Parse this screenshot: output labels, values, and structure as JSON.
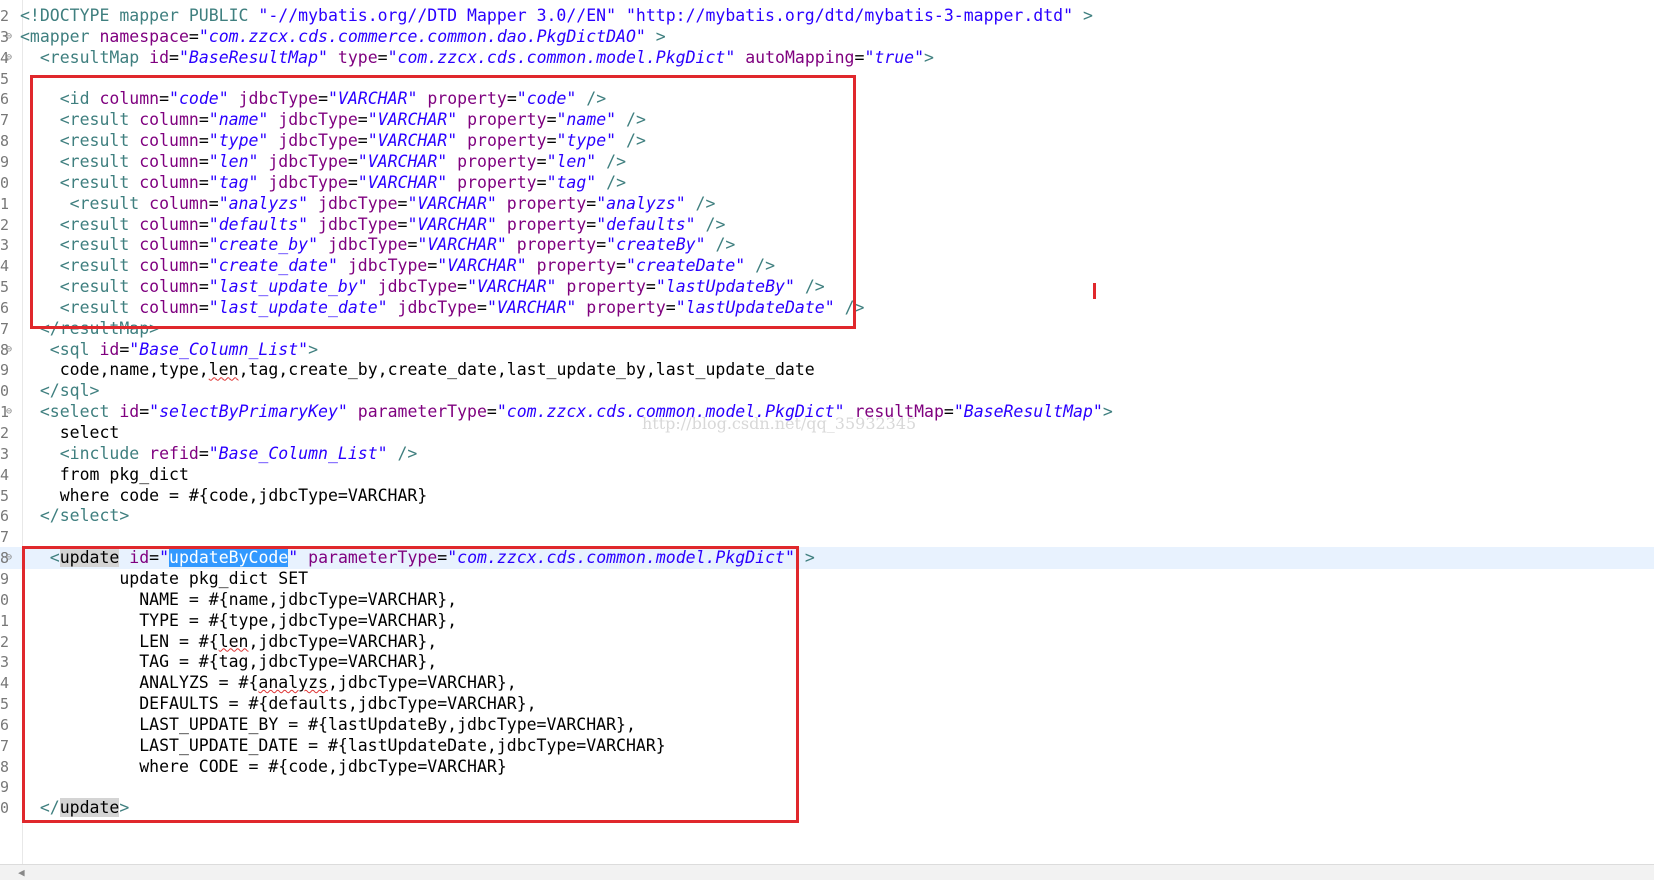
{
  "editor": {
    "lines": [
      {
        "no": "2",
        "fold": "",
        "segs": [
          [
            "tag",
            "<!DOCTYPE mapper PUBLIC "
          ],
          [
            "dval",
            "\"-//mybatis.org//DTD Mapper 3.0//EN\""
          ],
          [
            "tag",
            " "
          ],
          [
            "dval",
            "\"http://mybatis.org/dtd/mybatis-3-mapper.dtd\""
          ],
          [
            "tag",
            " >"
          ]
        ]
      },
      {
        "no": "3",
        "fold": "⊖",
        "segs": [
          [
            "tag",
            "<mapper "
          ],
          [
            "attr",
            "namespace"
          ],
          [
            "txt",
            "="
          ],
          [
            "val",
            "\"com.zzcx.cds.commerce.common.dao.PkgDictDAO\""
          ],
          [
            "tag",
            " >"
          ]
        ]
      },
      {
        "no": "4",
        "fold": "⊖",
        "segs": [
          [
            "tag",
            "  <resultMap "
          ],
          [
            "attr",
            "id"
          ],
          [
            "txt",
            "="
          ],
          [
            "val",
            "\"BaseResultMap\""
          ],
          [
            "tag",
            " "
          ],
          [
            "attr",
            "type"
          ],
          [
            "txt",
            "="
          ],
          [
            "val",
            "\"com.zzcx.cds.common.model.PkgDict\""
          ],
          [
            "tag",
            " "
          ],
          [
            "attr",
            "autoMapping"
          ],
          [
            "txt",
            "="
          ],
          [
            "val",
            "\"true\""
          ],
          [
            "tag",
            ">"
          ]
        ]
      },
      {
        "no": "5",
        "fold": "",
        "segs": []
      },
      {
        "no": "6",
        "fold": "",
        "segs": [
          [
            "tag",
            "    <id "
          ],
          [
            "attr",
            "column"
          ],
          [
            "txt",
            "="
          ],
          [
            "val",
            "\"code\""
          ],
          [
            "tag",
            " "
          ],
          [
            "attr",
            "jdbcType"
          ],
          [
            "txt",
            "="
          ],
          [
            "val",
            "\"VARCHAR\""
          ],
          [
            "tag",
            " "
          ],
          [
            "attr",
            "property"
          ],
          [
            "txt",
            "="
          ],
          [
            "val",
            "\"code\""
          ],
          [
            "tag",
            " />"
          ]
        ]
      },
      {
        "no": "7",
        "fold": "",
        "segs": [
          [
            "tag",
            "    <result "
          ],
          [
            "attr",
            "column"
          ],
          [
            "txt",
            "="
          ],
          [
            "val",
            "\"name\""
          ],
          [
            "tag",
            " "
          ],
          [
            "attr",
            "jdbcType"
          ],
          [
            "txt",
            "="
          ],
          [
            "val",
            "\"VARCHAR\""
          ],
          [
            "tag",
            " "
          ],
          [
            "attr",
            "property"
          ],
          [
            "txt",
            "="
          ],
          [
            "val",
            "\"name\""
          ],
          [
            "tag",
            " />"
          ]
        ]
      },
      {
        "no": "8",
        "fold": "",
        "segs": [
          [
            "tag",
            "    <result "
          ],
          [
            "attr",
            "column"
          ],
          [
            "txt",
            "="
          ],
          [
            "val",
            "\"type\""
          ],
          [
            "tag",
            " "
          ],
          [
            "attr",
            "jdbcType"
          ],
          [
            "txt",
            "="
          ],
          [
            "val",
            "\"VARCHAR\""
          ],
          [
            "tag",
            " "
          ],
          [
            "attr",
            "property"
          ],
          [
            "txt",
            "="
          ],
          [
            "val",
            "\"type\""
          ],
          [
            "tag",
            " />"
          ]
        ]
      },
      {
        "no": "9",
        "fold": "",
        "segs": [
          [
            "tag",
            "    <result "
          ],
          [
            "attr",
            "column"
          ],
          [
            "txt",
            "="
          ],
          [
            "val",
            "\"len\""
          ],
          [
            "tag",
            " "
          ],
          [
            "attr",
            "jdbcType"
          ],
          [
            "txt",
            "="
          ],
          [
            "val",
            "\"VARCHAR\""
          ],
          [
            "tag",
            " "
          ],
          [
            "attr",
            "property"
          ],
          [
            "txt",
            "="
          ],
          [
            "val",
            "\"len\""
          ],
          [
            "tag",
            " />"
          ]
        ]
      },
      {
        "no": "0",
        "fold": "",
        "segs": [
          [
            "tag",
            "    <result "
          ],
          [
            "attr",
            "column"
          ],
          [
            "txt",
            "="
          ],
          [
            "val",
            "\"tag\""
          ],
          [
            "tag",
            " "
          ],
          [
            "attr",
            "jdbcType"
          ],
          [
            "txt",
            "="
          ],
          [
            "val",
            "\"VARCHAR\""
          ],
          [
            "tag",
            " "
          ],
          [
            "attr",
            "property"
          ],
          [
            "txt",
            "="
          ],
          [
            "val",
            "\"tag\""
          ],
          [
            "tag",
            " />"
          ]
        ]
      },
      {
        "no": "1",
        "fold": "",
        "segs": [
          [
            "tag",
            "     <result "
          ],
          [
            "attr",
            "column"
          ],
          [
            "txt",
            "="
          ],
          [
            "val",
            "\"analyzs\""
          ],
          [
            "tag",
            " "
          ],
          [
            "attr",
            "jdbcType"
          ],
          [
            "txt",
            "="
          ],
          [
            "val",
            "\"VARCHAR\""
          ],
          [
            "tag",
            " "
          ],
          [
            "attr",
            "property"
          ],
          [
            "txt",
            "="
          ],
          [
            "val",
            "\"analyzs\""
          ],
          [
            "tag",
            " />"
          ]
        ]
      },
      {
        "no": "2",
        "fold": "",
        "segs": [
          [
            "tag",
            "    <result "
          ],
          [
            "attr",
            "column"
          ],
          [
            "txt",
            "="
          ],
          [
            "val",
            "\"defaults\""
          ],
          [
            "tag",
            " "
          ],
          [
            "attr",
            "jdbcType"
          ],
          [
            "txt",
            "="
          ],
          [
            "val",
            "\"VARCHAR\""
          ],
          [
            "tag",
            " "
          ],
          [
            "attr",
            "property"
          ],
          [
            "txt",
            "="
          ],
          [
            "val",
            "\"defaults\""
          ],
          [
            "tag",
            " />"
          ]
        ]
      },
      {
        "no": "3",
        "fold": "",
        "segs": [
          [
            "tag",
            "    <result "
          ],
          [
            "attr",
            "column"
          ],
          [
            "txt",
            "="
          ],
          [
            "val",
            "\"create_by\""
          ],
          [
            "tag",
            " "
          ],
          [
            "attr",
            "jdbcType"
          ],
          [
            "txt",
            "="
          ],
          [
            "val",
            "\"VARCHAR\""
          ],
          [
            "tag",
            " "
          ],
          [
            "attr",
            "property"
          ],
          [
            "txt",
            "="
          ],
          [
            "val",
            "\"createBy\""
          ],
          [
            "tag",
            " />"
          ]
        ]
      },
      {
        "no": "4",
        "fold": "",
        "segs": [
          [
            "tag",
            "    <result "
          ],
          [
            "attr",
            "column"
          ],
          [
            "txt",
            "="
          ],
          [
            "val",
            "\"create_date\""
          ],
          [
            "tag",
            " "
          ],
          [
            "attr",
            "jdbcType"
          ],
          [
            "txt",
            "="
          ],
          [
            "val",
            "\"VARCHAR\""
          ],
          [
            "tag",
            " "
          ],
          [
            "attr",
            "property"
          ],
          [
            "txt",
            "="
          ],
          [
            "val",
            "\"createDate\""
          ],
          [
            "tag",
            " />"
          ]
        ]
      },
      {
        "no": "5",
        "fold": "",
        "segs": [
          [
            "tag",
            "    <result "
          ],
          [
            "attr",
            "column"
          ],
          [
            "txt",
            "="
          ],
          [
            "val",
            "\"last_update_by\""
          ],
          [
            "tag",
            " "
          ],
          [
            "attr",
            "jdbcType"
          ],
          [
            "txt",
            "="
          ],
          [
            "val",
            "\"VARCHAR\""
          ],
          [
            "tag",
            " "
          ],
          [
            "attr",
            "property"
          ],
          [
            "txt",
            "="
          ],
          [
            "val",
            "\"lastUpdateBy\""
          ],
          [
            "tag",
            " />"
          ]
        ]
      },
      {
        "no": "6",
        "fold": "",
        "segs": [
          [
            "tag",
            "    <result "
          ],
          [
            "attr",
            "column"
          ],
          [
            "txt",
            "="
          ],
          [
            "val",
            "\"last_update_date\""
          ],
          [
            "tag",
            " "
          ],
          [
            "attr",
            "jdbcType"
          ],
          [
            "txt",
            "="
          ],
          [
            "val",
            "\"VARCHAR\""
          ],
          [
            "tag",
            " "
          ],
          [
            "attr",
            "property"
          ],
          [
            "txt",
            "="
          ],
          [
            "val",
            "\"lastUpdateDate\""
          ],
          [
            "tag",
            " />"
          ]
        ]
      },
      {
        "no": "7",
        "fold": "",
        "segs": [
          [
            "tag",
            "  </resultMap>"
          ]
        ]
      },
      {
        "no": "8",
        "fold": "⊖",
        "segs": [
          [
            "tag",
            "   <sql "
          ],
          [
            "attr",
            "id"
          ],
          [
            "txt",
            "="
          ],
          [
            "val",
            "\"Base_Column_List\""
          ],
          [
            "tag",
            ">"
          ]
        ]
      },
      {
        "no": "9",
        "fold": "",
        "segs": [
          [
            "txt",
            "    code,name,type,"
          ],
          [
            "squig",
            "len"
          ],
          [
            "txt",
            ",tag,create_by,create_date,last_update_by,last_update_date"
          ]
        ]
      },
      {
        "no": "0",
        "fold": "",
        "segs": [
          [
            "tag",
            "  </sql>"
          ]
        ]
      },
      {
        "no": "1",
        "fold": "⊖",
        "segs": [
          [
            "tag",
            "  <select "
          ],
          [
            "attr",
            "id"
          ],
          [
            "txt",
            "="
          ],
          [
            "val",
            "\"selectByPrimaryKey\""
          ],
          [
            "tag",
            " "
          ],
          [
            "attr",
            "parameterType"
          ],
          [
            "txt",
            "="
          ],
          [
            "val",
            "\"com.zzcx.cds.common.model.PkgDict\""
          ],
          [
            "tag",
            " "
          ],
          [
            "attr",
            "resultMap"
          ],
          [
            "txt",
            "="
          ],
          [
            "val",
            "\"BaseResultMap\""
          ],
          [
            "tag",
            ">"
          ]
        ]
      },
      {
        "no": "2",
        "fold": "",
        "segs": [
          [
            "txt",
            "    select"
          ]
        ]
      },
      {
        "no": "3",
        "fold": "",
        "segs": [
          [
            "tag",
            "    <include "
          ],
          [
            "attr",
            "refid"
          ],
          [
            "txt",
            "="
          ],
          [
            "val",
            "\"Base_Column_List\""
          ],
          [
            "tag",
            " />"
          ]
        ]
      },
      {
        "no": "4",
        "fold": "",
        "segs": [
          [
            "txt",
            "    from pkg_dict"
          ]
        ]
      },
      {
        "no": "5",
        "fold": "",
        "segs": [
          [
            "txt",
            "    where code = #{code,jdbcType=VARCHAR}"
          ]
        ]
      },
      {
        "no": "6",
        "fold": "",
        "segs": [
          [
            "tag",
            "  </select>"
          ]
        ]
      },
      {
        "no": "7",
        "fold": "",
        "segs": []
      },
      {
        "no": "8",
        "fold": "⊖",
        "current": true,
        "segs": [
          [
            "tag",
            "   <"
          ],
          [
            "occ",
            "update"
          ],
          [
            "tag",
            " "
          ],
          [
            "attr",
            "id"
          ],
          [
            "txt",
            "="
          ],
          [
            "val",
            "\""
          ],
          [
            "sel",
            "updateByCode"
          ],
          [
            "val",
            "\""
          ],
          [
            "tag",
            " "
          ],
          [
            "attr",
            "parameterType"
          ],
          [
            "txt",
            "="
          ],
          [
            "val",
            "\"com.zzcx.cds.common.model.PkgDict\""
          ],
          [
            "tag",
            " >"
          ]
        ]
      },
      {
        "no": "9",
        "fold": "",
        "segs": [
          [
            "txt",
            "          update pkg_dict SET"
          ]
        ]
      },
      {
        "no": "0",
        "fold": "",
        "segs": [
          [
            "txt",
            "            NAME = #{name,jdbcType=VARCHAR},"
          ]
        ]
      },
      {
        "no": "1",
        "fold": "",
        "segs": [
          [
            "txt",
            "            TYPE = #{type,jdbcType=VARCHAR},"
          ]
        ]
      },
      {
        "no": "2",
        "fold": "",
        "segs": [
          [
            "txt",
            "            LEN = #{"
          ],
          [
            "squig",
            "len"
          ],
          [
            "txt",
            ",jdbcType=VARCHAR},"
          ]
        ]
      },
      {
        "no": "3",
        "fold": "",
        "segs": [
          [
            "txt",
            "            TAG = #{tag,jdbcType=VARCHAR},"
          ]
        ]
      },
      {
        "no": "4",
        "fold": "",
        "segs": [
          [
            "txt",
            "            ANALYZS = #{"
          ],
          [
            "squig",
            "analyzs"
          ],
          [
            "txt",
            ",jdbcType=VARCHAR},"
          ]
        ]
      },
      {
        "no": "5",
        "fold": "",
        "segs": [
          [
            "txt",
            "            DEFAULTS = #{defaults,jdbcType=VARCHAR},"
          ]
        ]
      },
      {
        "no": "6",
        "fold": "",
        "segs": [
          [
            "txt",
            "            LAST_UPDATE_BY = #{lastUpdateBy,jdbcType=VARCHAR},"
          ]
        ]
      },
      {
        "no": "7",
        "fold": "",
        "segs": [
          [
            "txt",
            "            LAST_UPDATE_DATE = #{lastUpdateDate,jdbcType=VARCHAR}"
          ]
        ]
      },
      {
        "no": "8",
        "fold": "",
        "segs": [
          [
            "txt",
            "            where CODE = #{code,jdbcType=VARCHAR}"
          ]
        ]
      },
      {
        "no": "9",
        "fold": "",
        "segs": []
      },
      {
        "no": "0",
        "fold": "",
        "segs": [
          [
            "tag",
            "  </"
          ],
          [
            "occ",
            "update"
          ],
          [
            "tag",
            ">"
          ]
        ]
      }
    ],
    "watermark": "http://blog.csdn.net/qq_35932345"
  },
  "colors": {
    "highlight_box": "#e0282c",
    "tag": "#3f7f7f",
    "attribute": "#7f007f",
    "value": "#2a00ff",
    "selection": "#3399ff",
    "current_line": "#e8f2fe"
  }
}
